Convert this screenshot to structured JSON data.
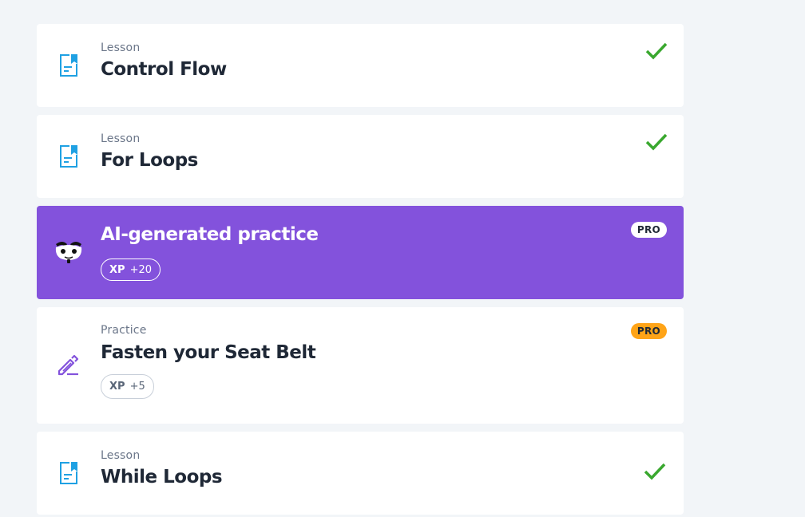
{
  "items": [
    {
      "kind": "Lesson",
      "title": "Control Flow",
      "icon": "lesson-document-icon",
      "status": "completed"
    },
    {
      "kind": "Lesson",
      "title": "For Loops",
      "icon": "lesson-document-icon",
      "status": "completed"
    },
    {
      "kind": "",
      "title": "AI-generated practice",
      "icon": "ai-mascot-icon",
      "badge": "PRO",
      "xp_label": "XP",
      "xp_value": "+20"
    },
    {
      "kind": "Practice",
      "title": "Fasten your Seat Belt",
      "icon": "pencil-practice-icon",
      "badge": "PRO",
      "xp_label": "XP",
      "xp_value": "+5"
    },
    {
      "kind": "Lesson",
      "title": "While Loops",
      "icon": "lesson-document-icon",
      "status": "completed"
    }
  ],
  "colors": {
    "background": "#f2f5f8",
    "card": "#ffffff",
    "ai_card": "#8352dc",
    "check": "#3aa82f",
    "lesson_icon": "#1fa1e3",
    "practice_icon": "#8352dc",
    "pro_badge_amber": "#ffa418"
  }
}
